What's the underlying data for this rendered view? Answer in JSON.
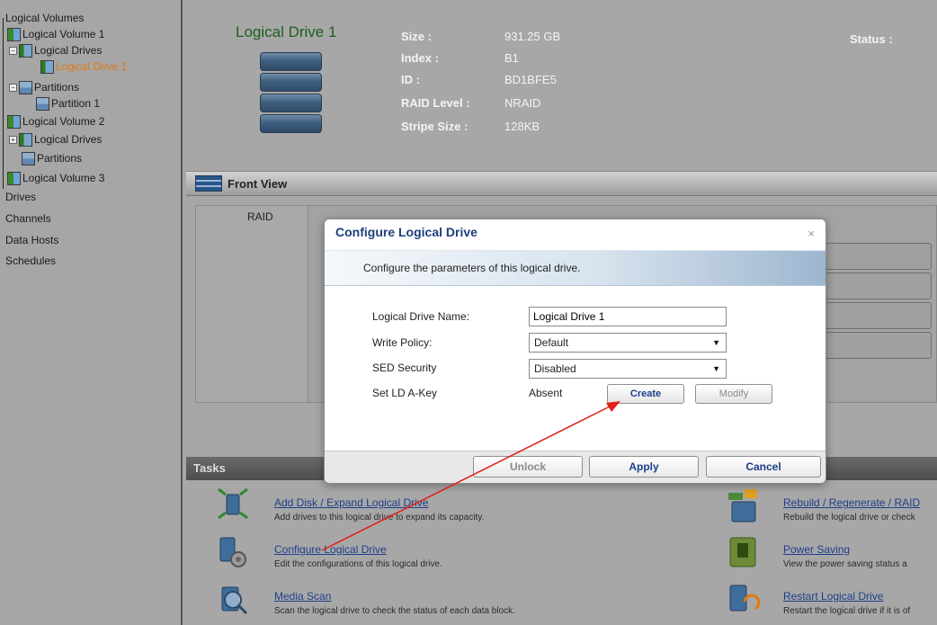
{
  "sidebar": {
    "items": [
      {
        "label": "Logical Volumes"
      },
      {
        "label": "Logical Volume 1"
      },
      {
        "label": "Logical Drives"
      },
      {
        "label": "Logical Drive 1"
      },
      {
        "label": "Partitions"
      },
      {
        "label": "Partition 1"
      },
      {
        "label": "Logical Volume 2"
      },
      {
        "label": "Logical Drives"
      },
      {
        "label": "Partitions"
      },
      {
        "label": "Logical Volume 3"
      },
      {
        "label": "Drives"
      },
      {
        "label": "Channels"
      },
      {
        "label": "Data Hosts"
      },
      {
        "label": "Schedules"
      }
    ]
  },
  "details": {
    "title": "Logical Drive 1",
    "size_label": "Size :",
    "size_value": "931.25 GB",
    "index_label": "Index :",
    "index_value": "B1",
    "id_label": "ID :",
    "id_value": "BD1BFE5",
    "raid_label": "RAID Level :",
    "raid_value": "NRAID",
    "stripe_label": "Stripe Size :",
    "stripe_value": "128KB",
    "status_label": "Status :"
  },
  "front_view": {
    "title": "Front View",
    "raid_label": "RAID"
  },
  "tasks": {
    "title": "Tasks",
    "add_disk": "Add Disk",
    "slash": "/",
    "expand": "Expand Logical Drive",
    "add_desc": "Add drives to this logical drive to expand its capacity.",
    "configure": "Configure Logical Drive",
    "configure_desc": "Edit the configurations of this logical drive.",
    "media_scan": "Media Scan",
    "media_desc": "Scan the logical drive to check the status of each data block.",
    "rebuild": "Rebuild",
    "regenerate": "Regenerate",
    "raid_link": "RAID",
    "rebuild_desc": "Rebuild the logical drive or check",
    "power_saving": "Power Saving",
    "power_desc": "View the power saving status a",
    "restart": "Restart Logical Drive",
    "restart_desc": "Restart the logical drive if it is of"
  },
  "dialog": {
    "title": "Configure Logical Drive",
    "close": "×",
    "description": "Configure the parameters of this logical drive.",
    "name_label": "Logical Drive Name:",
    "name_value": "Logical Drive 1",
    "write_policy_label": "Write Policy:",
    "write_policy_value": "Default",
    "sed_label": "SED Security",
    "sed_value": "Disabled",
    "akey_label": "Set LD A-Key",
    "akey_value": "Absent",
    "create": "Create",
    "modify": "Modify",
    "unlock": "Unlock",
    "apply": "Apply",
    "cancel": "Cancel",
    "dropdown_arrow": "▼"
  },
  "colors": {
    "dialog_title": "#1d3f7a",
    "selected_tree_item": "#e07a10",
    "annotation_arrow": "#e0201a"
  }
}
